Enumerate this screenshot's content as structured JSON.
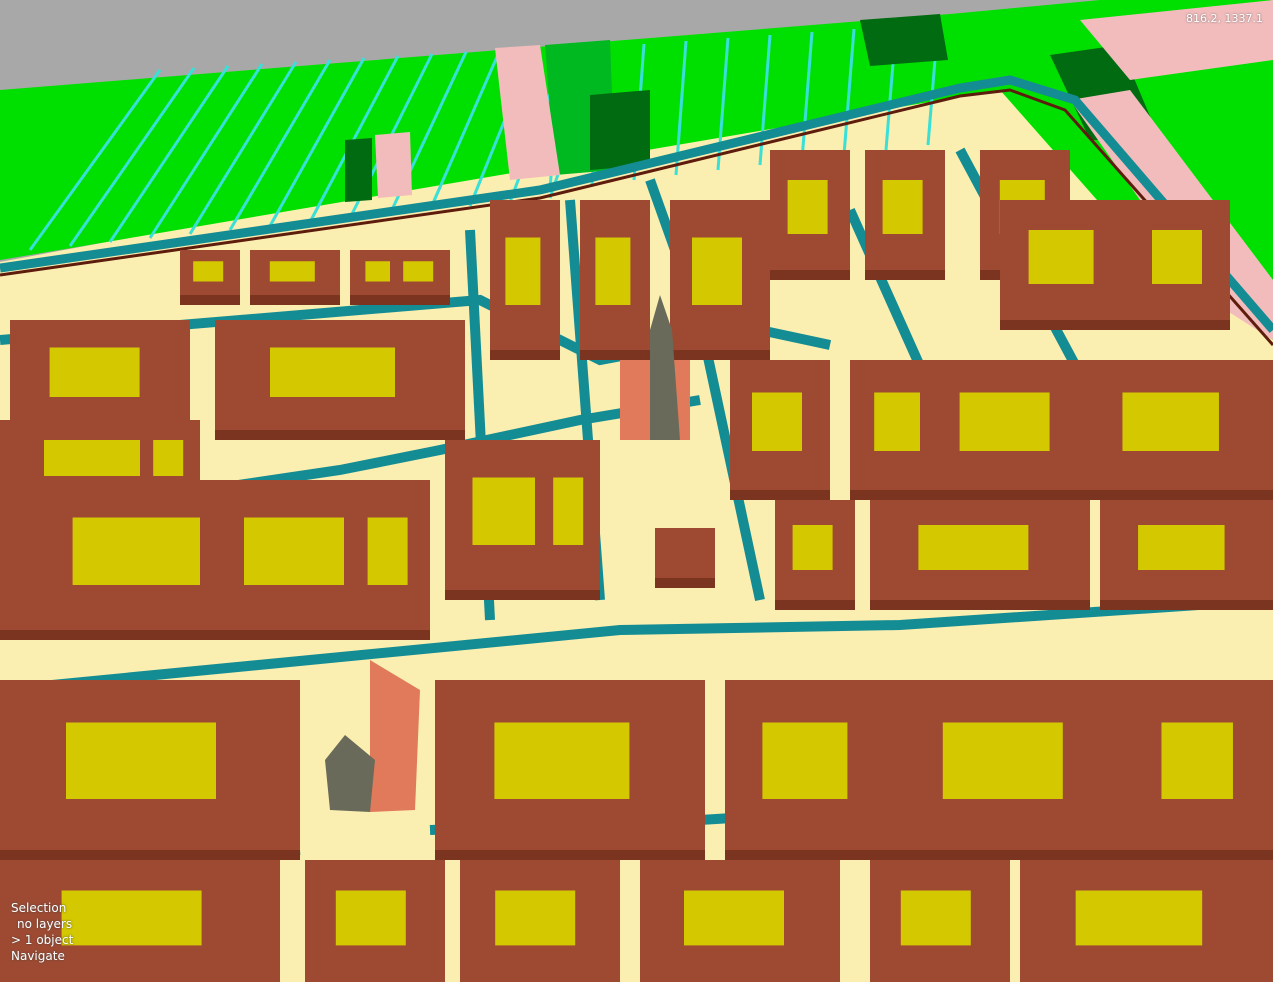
{
  "colors": {
    "sky": "#a8a8a8",
    "field": "#00e000",
    "field_dark": "#006b10",
    "field_mid": "#00b820",
    "ditch": "#38e0d8",
    "pasture_pink": "#f2bcbc",
    "road": "#faeeb0",
    "canal": "#148c94",
    "wall": "#5e1c0c",
    "building_top": "#9e4a32",
    "building_side": "#7a3420",
    "courtyard": "#d4c800",
    "church_light": "#e07a5a",
    "tower": "#6a6a5a"
  },
  "readout": {
    "coords": "816.2, 1337.1"
  },
  "status": {
    "line1": "Selection",
    "line2": "no layers",
    "line3": "> 1 object",
    "line4": "Navigate"
  }
}
